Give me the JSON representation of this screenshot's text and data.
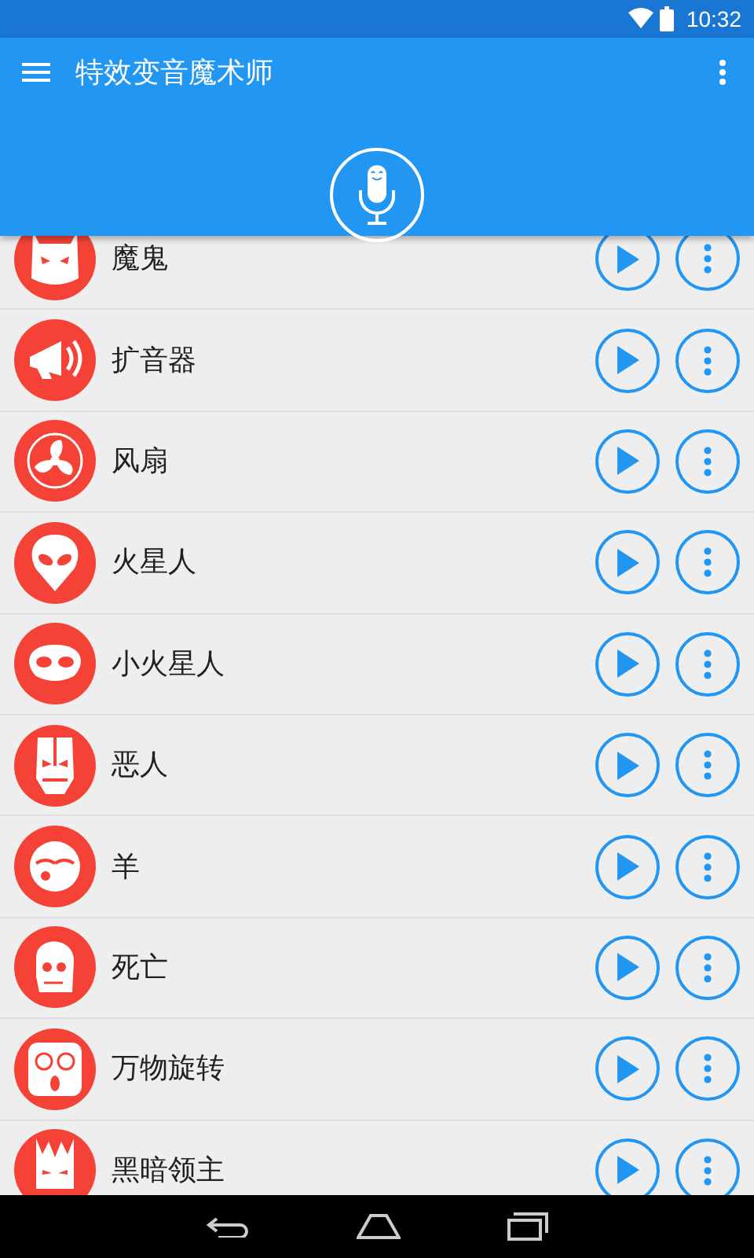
{
  "status_bar": {
    "time": "10:32"
  },
  "app_bar": {
    "title": "特效变音魔术师"
  },
  "effects": [
    {
      "name": "魔鬼"
    },
    {
      "name": "扩音器"
    },
    {
      "name": "风扇"
    },
    {
      "name": "火星人"
    },
    {
      "name": "小火星人"
    },
    {
      "name": "恶人"
    },
    {
      "name": "羊"
    },
    {
      "name": "死亡"
    },
    {
      "name": "万物旋转"
    },
    {
      "name": "黑暗领主"
    }
  ]
}
